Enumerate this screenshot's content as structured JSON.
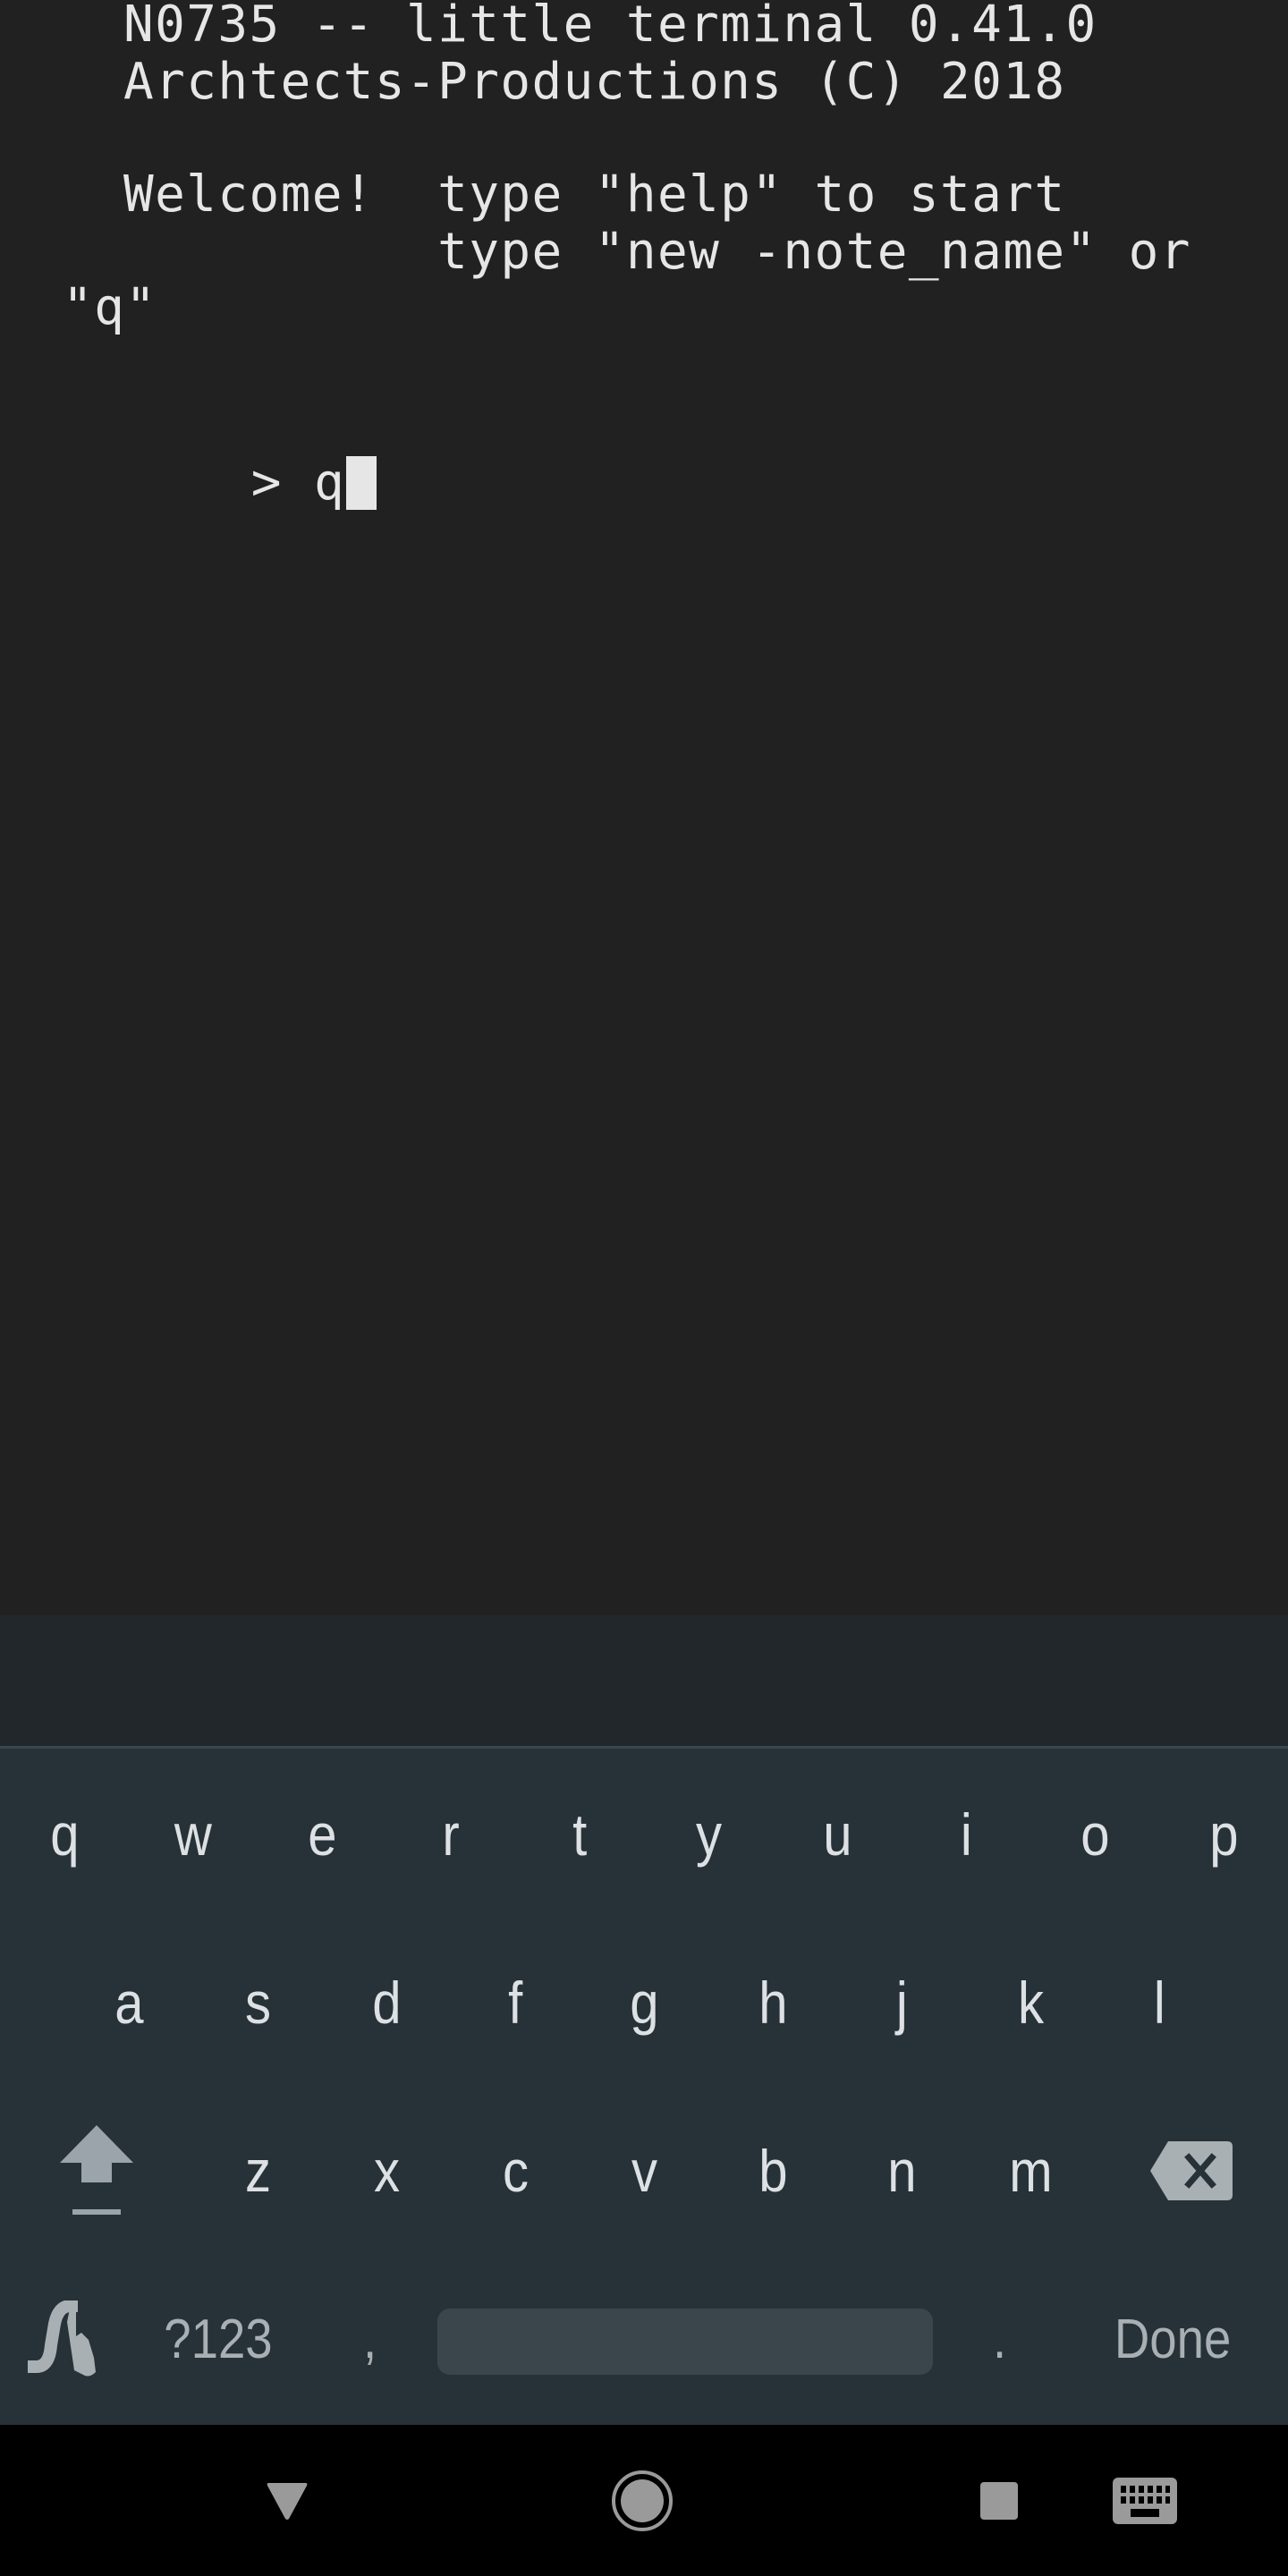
{
  "terminal": {
    "lines": [
      "N0735 -- little terminal 0.41.0",
      "Archtects-Productions (C) 2018",
      "Welcome!  type \"help\" to start",
      "          type \"new -note_name\" or",
      "\"q\""
    ],
    "prompt_symbol": ">",
    "input_value": "q"
  },
  "keyboard": {
    "row1": [
      "q",
      "w",
      "e",
      "r",
      "t",
      "y",
      "u",
      "i",
      "o",
      "p"
    ],
    "row2": [
      "a",
      "s",
      "d",
      "f",
      "g",
      "h",
      "j",
      "k",
      "l"
    ],
    "row3": [
      "z",
      "x",
      "c",
      "v",
      "b",
      "n",
      "m"
    ],
    "symbols_label": "?123",
    "comma_label": ",",
    "period_label": ".",
    "done_label": "Done",
    "icons": {
      "shift": "shift-icon",
      "backspace": "backspace-icon",
      "gesture": "gesture-typing-icon"
    }
  },
  "navbar": {
    "icons": [
      "back-icon",
      "home-icon",
      "recents-icon",
      "keyboard-switch-icon"
    ]
  },
  "colors": {
    "terminal_bg": "#212121",
    "terminal_text": "#e6e6e6",
    "keyboard_bg": "#263238",
    "suggestion_bg": "#21272b",
    "key_text": "#dde1e4",
    "icon_gray": "#9aa4aa"
  }
}
